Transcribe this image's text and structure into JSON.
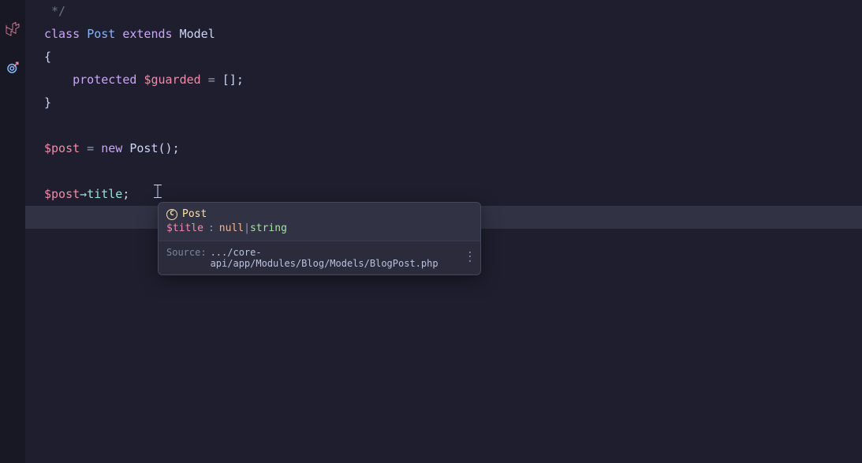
{
  "sidebar": {
    "icons": [
      "laravel-icon",
      "target-icon"
    ]
  },
  "code": {
    "l0_comment_end": " */",
    "l1_class": "class",
    "l1_name": "Post",
    "l1_extends": "extends",
    "l1_model": "Model",
    "l2_brace": "{",
    "l3_indent": "    ",
    "l3_protected": "protected",
    "l3_var": "$guarded",
    "l3_eq": " = ",
    "l3_arr": "[]",
    "l3_semi": ";",
    "l4_brace": "}",
    "l6_var": "$post",
    "l6_eq": " = ",
    "l6_new": "new",
    "l6_cls": " Post",
    "l6_paren": "()",
    "l6_semi": ";",
    "l8_var": "$post",
    "l8_arrow": "→",
    "l8_prop": "title",
    "l8_semi": ";"
  },
  "tooltip": {
    "class_badge": "C",
    "class_name": "Post",
    "prop_var": "$title",
    "prop_colon": ":",
    "type_null": "null",
    "type_pipe": "|",
    "type_string": "string",
    "source_label": "Source:",
    "source_path": ".../core-api/app/Modules/Blog/Models/BlogPost.php"
  }
}
